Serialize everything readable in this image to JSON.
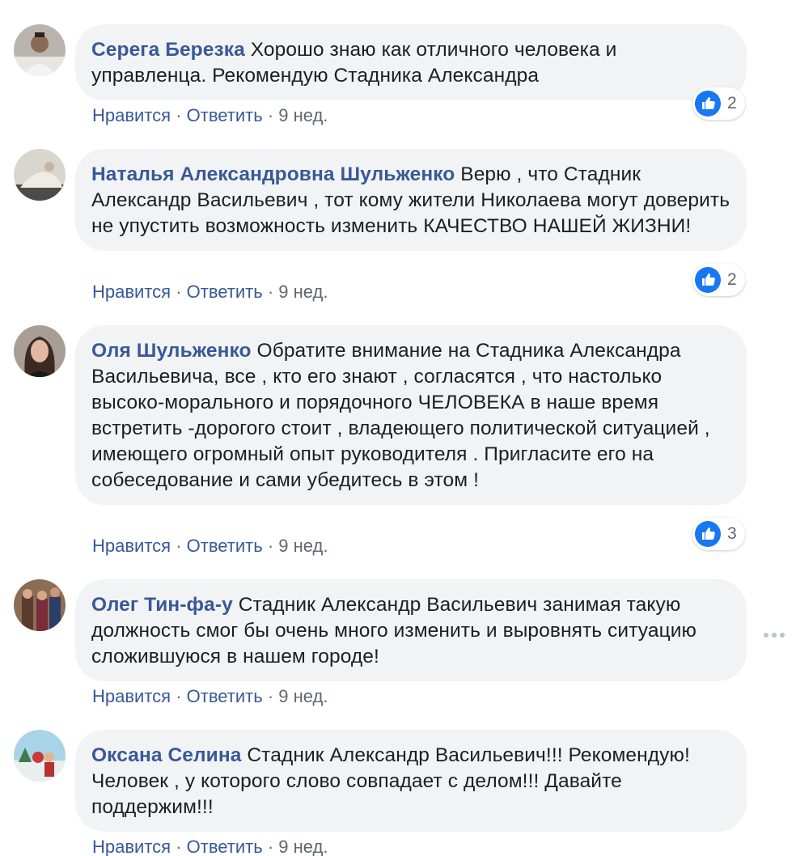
{
  "colors": {
    "author": "#385898",
    "action": "#385898",
    "meta": "#606770",
    "bubble_bg": "#f2f3f5",
    "like_blue": "#1877f2"
  },
  "actions": {
    "like_label": "Нравится",
    "reply_label": "Ответить",
    "separator": "·"
  },
  "comments": [
    {
      "author": "Серега Березка",
      "text": "Хорошо знаю как отличного человека и управленца. Рекомендую Стадника Александра",
      "time": "9 нед.",
      "reactions": {
        "icon": "like-icon",
        "count": "2"
      }
    },
    {
      "author": "Наталья Александровна Шульженко",
      "text": "Верю , что Стадник Александр Васильевич , тот кому жители Николаева могут доверить не упустить возможность изменить КАЧЕСТВО НАШЕЙ ЖИЗНИ!",
      "time": "9 нед.",
      "reactions": {
        "icon": "like-icon",
        "count": "2"
      }
    },
    {
      "author": "Оля Шульженко",
      "text": "Обратите внимание на Стадника Александра Васильевича, все , кто его знают , согласятся , что настолько высоко-морального и порядочного ЧЕЛОВЕКА в наше время встретить -дорогого стоит , владеющего политической ситуацией , имеющего огромный опыт руководителя . Пригласите его на собеседование и сами убедитесь в этом !",
      "time": "9 нед.",
      "reactions": {
        "icon": "like-icon",
        "count": "3"
      }
    },
    {
      "author": "Олег Тин-фа-у",
      "text": "Стадник Александр Васильевич занимая такую должность смог бы очень много изменить и выровнять ситуацию сложившуюся в нашем городе!",
      "time": "9 нед."
    },
    {
      "author": "Оксана Селина",
      "text": "Стадник Александр Васильевич!!! Рекомендую! Человек , у которого слово совпадает с делом!!! Давайте поддержим!!!",
      "time": "9 нед."
    }
  ]
}
